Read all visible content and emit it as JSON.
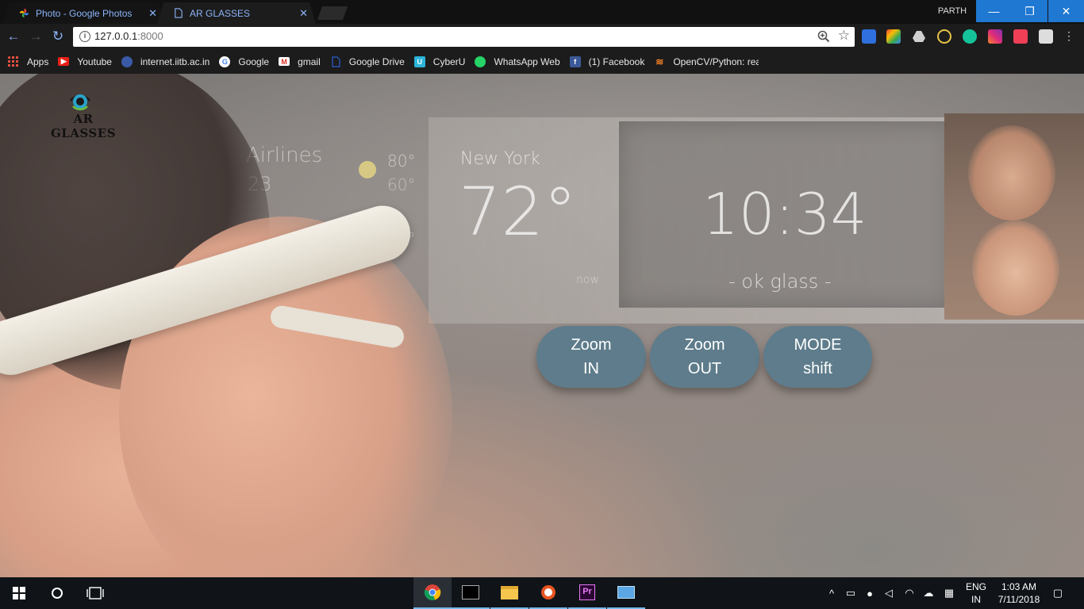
{
  "browser": {
    "tabs": [
      {
        "title": "Photo - Google Photos",
        "close": "✕",
        "active": false
      },
      {
        "title": "AR GLASSES",
        "close": "✕",
        "active": true
      }
    ],
    "profile": "PARTH",
    "window_controls": {
      "minimize": "—",
      "maximize": "❐",
      "close": "✕"
    },
    "nav": {
      "back": "←",
      "forward": "→",
      "reload": "↻"
    },
    "address": {
      "host": "127.0.0.1",
      "port": ":8000"
    },
    "extensions": [
      "docs-icon",
      "s-extension-icon",
      "drive-icon",
      "coin-icon",
      "grammarly-icon",
      "instagram-icon",
      "pocket-icon",
      "extension-icon",
      "menu-icon"
    ]
  },
  "bookmarks": [
    {
      "label": "Apps",
      "icon": "apps-grid-icon",
      "color": "#e6503d"
    },
    {
      "label": "Youtube",
      "icon": "youtube-icon",
      "color": "#e62117"
    },
    {
      "label": "internet.iitb.ac.in",
      "icon": "iitb-icon",
      "color": "#3a5aa8"
    },
    {
      "label": "Google",
      "icon": "google-icon",
      "color": "#ffffff"
    },
    {
      "label": "gmail",
      "icon": "gmail-icon",
      "color": "#d93025"
    },
    {
      "label": "Google Drive",
      "icon": "page-icon",
      "color": "#2a5ed6"
    },
    {
      "label": "CyberU",
      "icon": "cyberu-icon",
      "color": "#2bb3d9"
    },
    {
      "label": "WhatsApp Web",
      "icon": "whatsapp-icon",
      "color": "#25d366"
    },
    {
      "label": "(1) Facebook",
      "icon": "facebook-icon",
      "color": "#3b5998"
    },
    {
      "label": "OpenCV/Python: rea",
      "icon": "stackoverflow-icon",
      "color": "#f48024"
    }
  ],
  "page": {
    "logo_text": "AR GLASSES",
    "hud": {
      "airline": "Airlines",
      "airline_sub": "23",
      "temp_high": "80°",
      "temp_low": "60°",
      "rain": "30°",
      "city": "New York",
      "temperature": "72°",
      "now": "now",
      "time": "10:34",
      "ok_glass": "- ok glass -"
    },
    "controls": [
      {
        "line1": "Zoom",
        "line2": "IN"
      },
      {
        "line1": "Zoom",
        "line2": "OUT"
      },
      {
        "line1": "MODE",
        "line2": "shift"
      }
    ],
    "button_color": "#5e7c8b"
  },
  "taskbar": {
    "apps": [
      "chrome-icon",
      "terminal-icon",
      "file-explorer-icon",
      "ubuntu-icon",
      "premiere-pro-icon",
      "remote-desktop-icon"
    ],
    "language": {
      "line1": "ENG",
      "line2": "IN"
    },
    "clock": {
      "time": "1:03 AM",
      "date": "7/11/2018"
    }
  }
}
